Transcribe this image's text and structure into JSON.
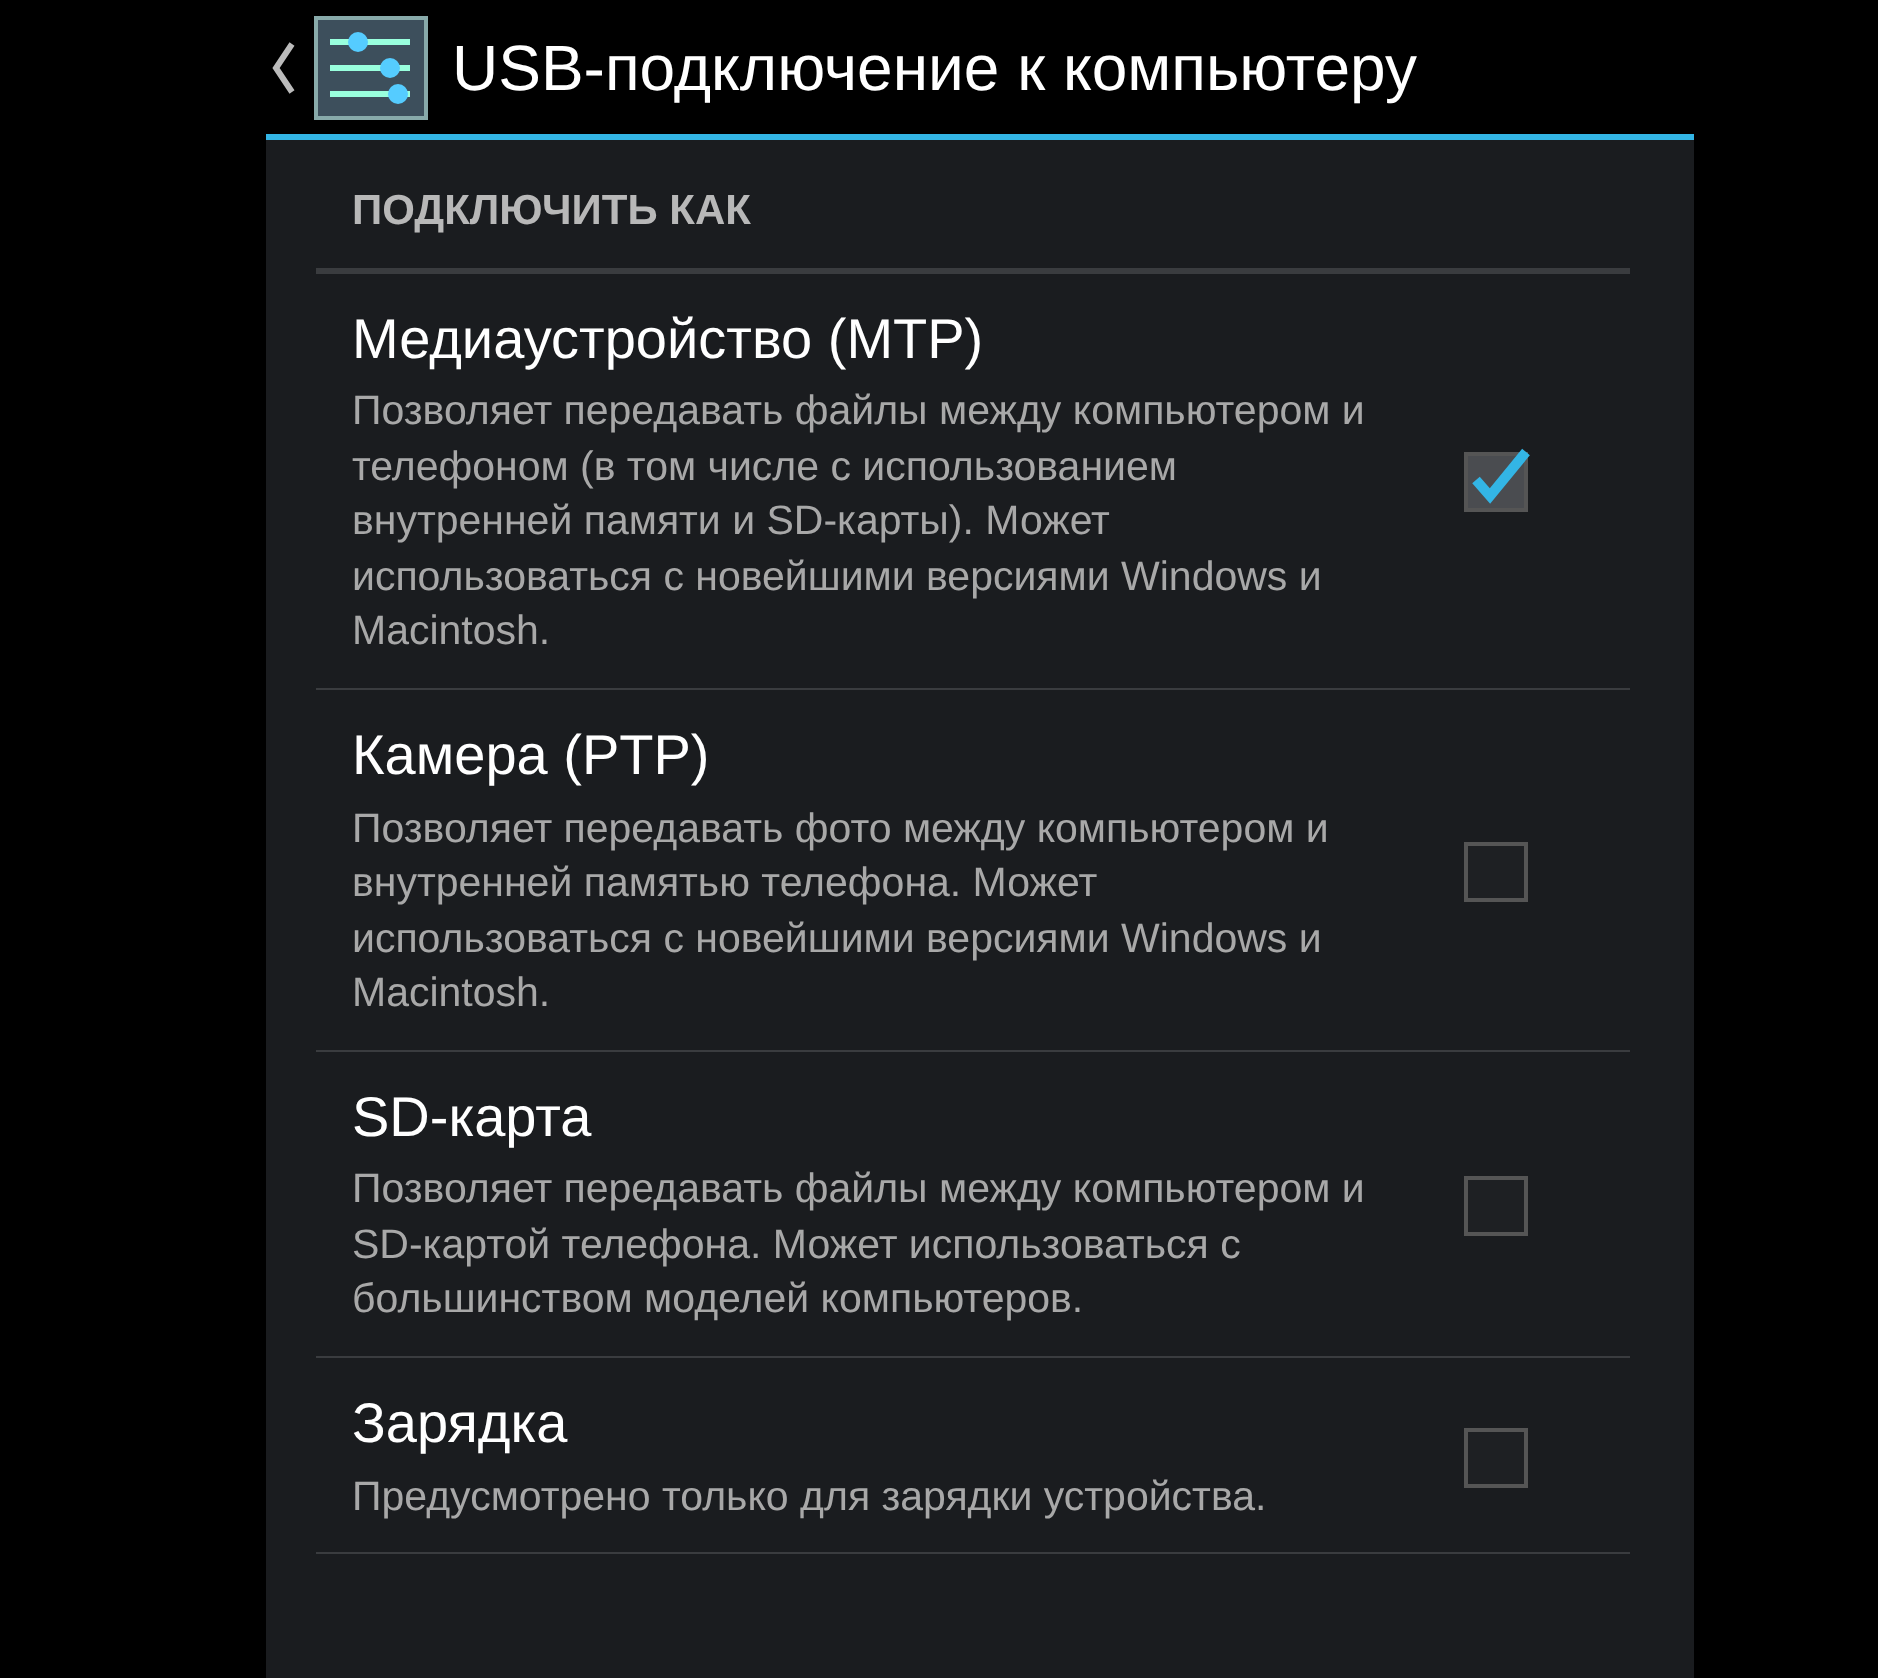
{
  "action_bar": {
    "title": "USB-подключение к компьютеру"
  },
  "section": {
    "title": "ПОДКЛЮЧИТЬ КАК"
  },
  "options": [
    {
      "title": "Медиаустройство (MTP)",
      "summary": "Позволяет передавать файлы между компьютером и телефоном (в том числе с использованием внутренней памяти и SD-карты). Может использоваться с новейшими версиями Windows и Macintosh.",
      "checked": true
    },
    {
      "title": "Камера (PTP)",
      "summary": "Позволяет передавать фото между компьютером и внутренней памятью телефона. Может использоваться с новейшими версиями Windows и Macintosh.",
      "checked": false
    },
    {
      "title": "SD-карта",
      "summary": "Позволяет передавать файлы между компьютером и SD-картой телефона. Может использоваться с большинством моделей компьютеров.",
      "checked": false
    },
    {
      "title": "Зарядка",
      "summary": "Предусмотрено только для зарядки устройства.",
      "checked": false
    }
  ]
}
